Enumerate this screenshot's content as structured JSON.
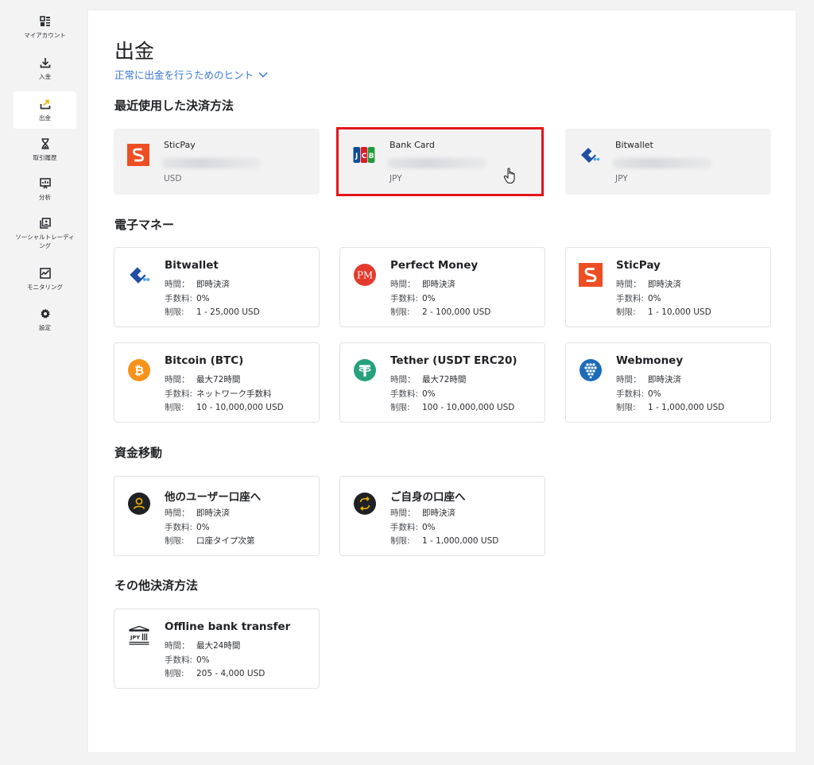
{
  "sidebar": {
    "items": [
      {
        "label": "マイアカウント",
        "icon": "dashboard-icon",
        "active": false
      },
      {
        "label": "入金",
        "icon": "download-icon",
        "active": false
      },
      {
        "label": "出金",
        "icon": "withdraw-icon",
        "active": true
      },
      {
        "label": "取引履歴",
        "icon": "hourglass-icon",
        "active": false
      },
      {
        "label": "分析",
        "icon": "analytics-icon",
        "active": false
      },
      {
        "label": "ソーシャルトレーディング",
        "icon": "social-trading-icon",
        "active": false
      },
      {
        "label": "モニタリング",
        "icon": "monitoring-icon",
        "active": false
      },
      {
        "label": "設定",
        "icon": "gear-icon",
        "active": false
      }
    ]
  },
  "page": {
    "title": "出金",
    "hint_link": "正常に出金を行うためのヒント"
  },
  "sections": {
    "recent": "最近使用した決済方法",
    "emoney": "電子マネー",
    "transfer": "資金移動",
    "other": "その他決済方法"
  },
  "recent": [
    {
      "name": "SticPay",
      "currency": "USD",
      "icon": "sticpay-logo"
    },
    {
      "name": "Bank Card",
      "currency": "JPY",
      "icon": "jcb-logo"
    },
    {
      "name": "Bitwallet",
      "currency": "JPY",
      "icon": "bitwallet-logo"
    }
  ],
  "labels": {
    "time": "時間：",
    "fee": "手数料:",
    "limit": "制限:"
  },
  "emoney": [
    {
      "name": "Bitwallet",
      "time": "即時決済",
      "fee": "0%",
      "limit": "1 - 25,000 USD",
      "icon": "bitwallet-logo"
    },
    {
      "name": "Perfect Money",
      "time": "即時決済",
      "fee": "0%",
      "limit": "2 - 100,000 USD",
      "icon": "perfect-money-logo"
    },
    {
      "name": "SticPay",
      "time": "即時決済",
      "fee": "0%",
      "limit": "1 - 10,000 USD",
      "icon": "sticpay-logo"
    },
    {
      "name": "Bitcoin (BTC)",
      "time": "最大72時間",
      "fee": "ネットワーク手数料",
      "limit": "10 - 10,000,000 USD",
      "icon": "bitcoin-logo"
    },
    {
      "name": "Tether (USDT ERC20)",
      "time": "最大72時間",
      "fee": "0%",
      "limit": "100 - 10,000,000 USD",
      "icon": "tether-logo"
    },
    {
      "name": "Webmoney",
      "time": "即時決済",
      "fee": "0%",
      "limit": "1 - 1,000,000 USD",
      "icon": "webmoney-logo"
    }
  ],
  "transfer": [
    {
      "name": "他のユーザー口座へ",
      "time": "即時決済",
      "fee": "0%",
      "limit": "口座タイプ次第",
      "icon": "user-icon"
    },
    {
      "name": "ご自身の口座へ",
      "time": "即時決済",
      "fee": "0%",
      "limit": "1 - 1,000,000 USD",
      "icon": "transfer-arrows-icon"
    }
  ],
  "other": [
    {
      "name": "Offline bank transfer",
      "time": "最大24時間",
      "fee": "0%",
      "limit": "205 - 4,000 USD",
      "icon": "bank-jpy-icon",
      "icon_text": "JPY"
    }
  ],
  "colors": {
    "accent_link": "#3b77d1",
    "active_icon": "#f0b400",
    "highlight": "#e3151a",
    "sticpay": "#ee4e23"
  }
}
